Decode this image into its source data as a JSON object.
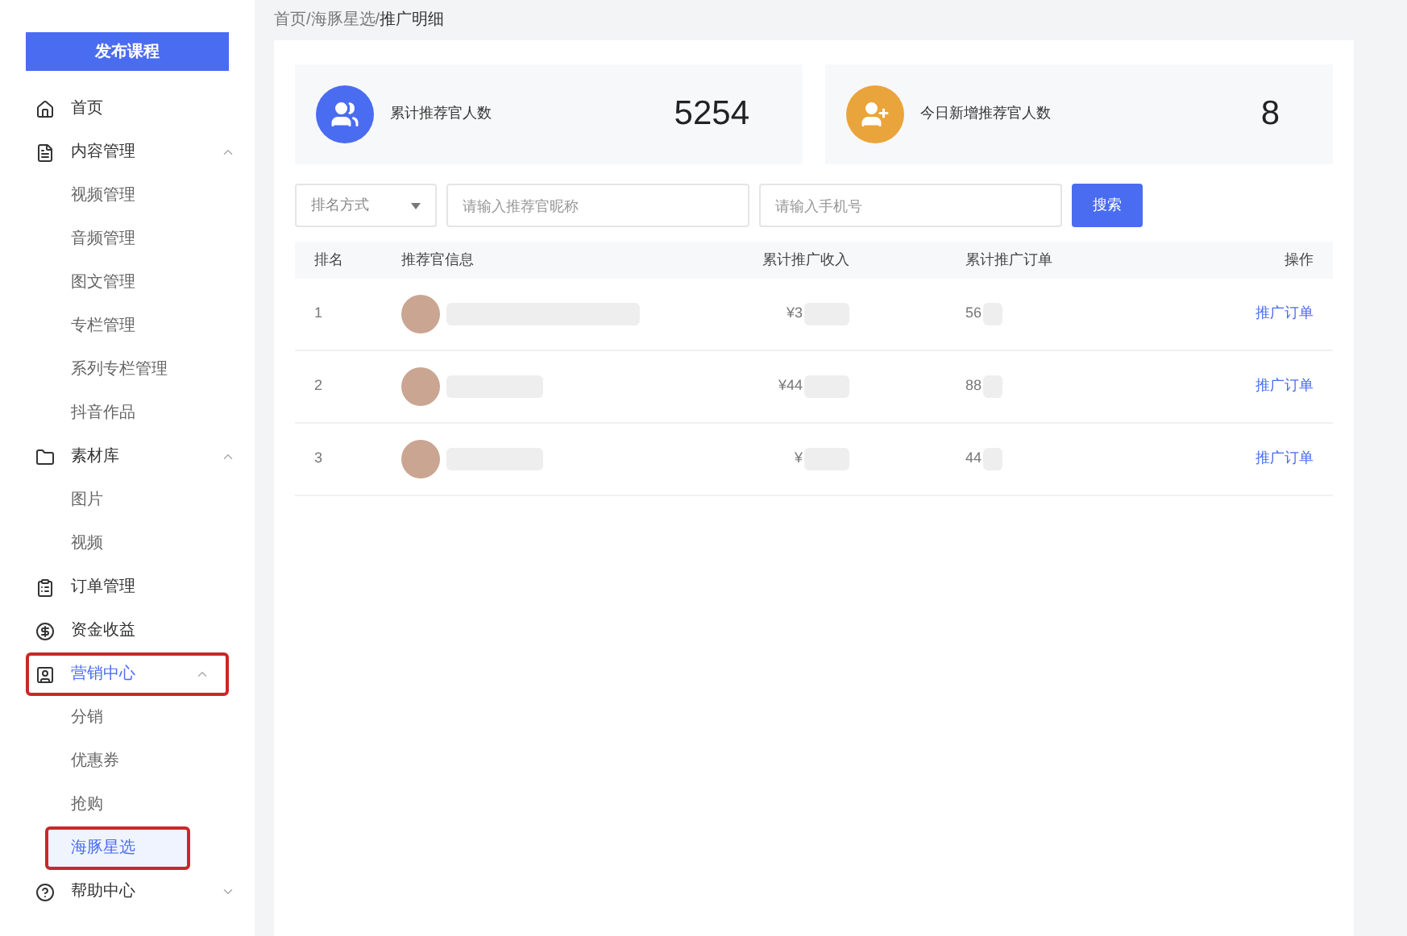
{
  "sidebar": {
    "publish_button": "发布课程",
    "items": [
      {
        "kind": "item",
        "label": "首页",
        "selected": false,
        "highlighted": false
      },
      {
        "kind": "group",
        "label": "内容管理",
        "expanded": true,
        "selected": false,
        "highlighted": false
      },
      {
        "kind": "sub",
        "label": "视频管理",
        "selected": false,
        "highlighted": false
      },
      {
        "kind": "sub",
        "label": "音频管理",
        "selected": false,
        "highlighted": false
      },
      {
        "kind": "sub",
        "label": "图文管理",
        "selected": false,
        "highlighted": false
      },
      {
        "kind": "sub",
        "label": "专栏管理",
        "selected": false,
        "highlighted": false
      },
      {
        "kind": "sub",
        "label": "系列专栏管理",
        "selected": false,
        "highlighted": false
      },
      {
        "kind": "sub",
        "label": "抖音作品",
        "selected": false,
        "highlighted": false
      },
      {
        "kind": "group",
        "label": "素材库",
        "expanded": true,
        "selected": false,
        "highlighted": false
      },
      {
        "kind": "sub",
        "label": "图片",
        "selected": false,
        "highlighted": false
      },
      {
        "kind": "sub",
        "label": "视频",
        "selected": false,
        "highlighted": false
      },
      {
        "kind": "item",
        "label": "订单管理",
        "selected": false,
        "highlighted": false
      },
      {
        "kind": "item",
        "label": "资金收益",
        "selected": false,
        "highlighted": false
      },
      {
        "kind": "group",
        "label": "营销中心",
        "expanded": true,
        "selected": true,
        "highlighted": true
      },
      {
        "kind": "sub",
        "label": "分销",
        "selected": false,
        "highlighted": false
      },
      {
        "kind": "sub",
        "label": "优惠券",
        "selected": false,
        "highlighted": false
      },
      {
        "kind": "sub",
        "label": "抢购",
        "selected": false,
        "highlighted": false
      },
      {
        "kind": "sub",
        "label": "海豚星选",
        "selected": true,
        "highlighted": true
      },
      {
        "kind": "group",
        "label": "帮助中心",
        "expanded": false,
        "selected": false,
        "highlighted": false
      }
    ]
  },
  "breadcrumb": {
    "path": "首页/海豚星选/",
    "current": "推广明细"
  },
  "stats": [
    {
      "kind": "total",
      "label": "累计推荐官人数",
      "value": "5254"
    },
    {
      "kind": "today",
      "label": "今日新增推荐官人数",
      "value": "8"
    }
  ],
  "filters": {
    "sort": {
      "placeholder": "排名方式"
    },
    "nickname": {
      "placeholder": "请输入推荐官昵称"
    },
    "phone": {
      "placeholder": "请输入手机号"
    },
    "search_button": "搜索"
  },
  "table": {
    "columns": [
      "排名",
      "推荐官信息",
      "累计推广收入",
      "累计推广订单",
      "操作"
    ],
    "rows": [
      {
        "rank": "1",
        "income": "¥3",
        "orders": "56",
        "action": "推广订单"
      },
      {
        "rank": "2",
        "income": "¥44",
        "orders": "88",
        "action": "推广订单"
      },
      {
        "rank": "3",
        "income": "¥",
        "orders": "44",
        "action": "推广订单"
      }
    ]
  }
}
